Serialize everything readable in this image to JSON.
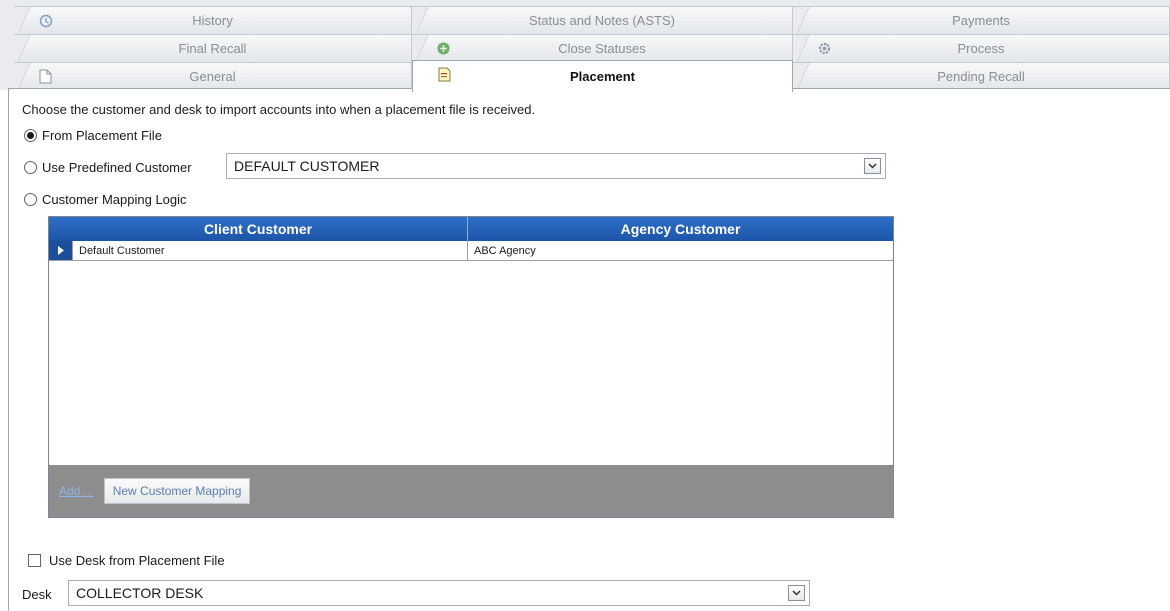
{
  "tabs": {
    "history": "History",
    "status_notes": "Status and Notes (ASTS)",
    "payments": "Payments",
    "final_recall": "Final Recall",
    "close_statuses": "Close Statuses",
    "process": "Process",
    "general": "General",
    "placement": "Placement",
    "pending_recall": "Pending Recall"
  },
  "active_tab": "Placement",
  "instruction": "Choose the customer and desk to import accounts into when a placement file is received.",
  "options": {
    "from_file": "From Placement File",
    "predefined": "Use Predefined Customer",
    "mapping": "Customer Mapping Logic",
    "selected": "from_file"
  },
  "predefined_customer": {
    "value": "DEFAULT CUSTOMER"
  },
  "grid": {
    "headers": {
      "client": "Client Customer",
      "agency": "Agency Customer"
    },
    "rows": [
      {
        "client": "Default Customer",
        "agency": "ABC Agency"
      }
    ]
  },
  "footer": {
    "add_link": "Add ...",
    "new_mapping_button": "New Customer Mapping"
  },
  "use_desk_checkbox": {
    "label": "Use Desk from Placement File",
    "checked": false
  },
  "desk": {
    "label": "Desk",
    "value": "COLLECTOR DESK"
  },
  "colors": {
    "grid_header": "#1f5cb3",
    "grid_footer": "#8d8d8d",
    "link": "#8fb6e6"
  }
}
